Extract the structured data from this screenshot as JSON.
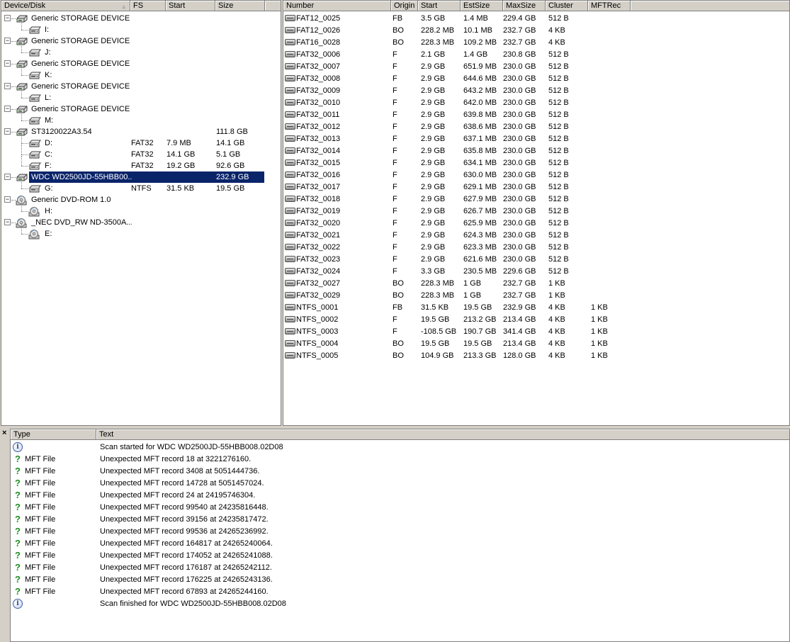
{
  "left": {
    "headers": [
      "Device/Disk",
      "FS",
      "Start",
      "Size"
    ],
    "rows": [
      {
        "kind": "disk",
        "name": "Generic STORAGE DEVICE ...",
        "fs": "",
        "start": "",
        "size": "",
        "icon": "usb-disk-icon"
      },
      {
        "kind": "part",
        "name": "I:",
        "fs": "",
        "start": "",
        "size": "",
        "icon": "drive-icon"
      },
      {
        "kind": "disk",
        "name": "Generic STORAGE DEVICE ...",
        "fs": "",
        "start": "",
        "size": "",
        "icon": "usb-disk-icon"
      },
      {
        "kind": "part",
        "name": "J:",
        "fs": "",
        "start": "",
        "size": "",
        "icon": "drive-icon"
      },
      {
        "kind": "disk",
        "name": "Generic STORAGE DEVICE ...",
        "fs": "",
        "start": "",
        "size": "",
        "icon": "usb-disk-icon"
      },
      {
        "kind": "part",
        "name": "K:",
        "fs": "",
        "start": "",
        "size": "",
        "icon": "drive-icon"
      },
      {
        "kind": "disk",
        "name": "Generic STORAGE DEVICE ...",
        "fs": "",
        "start": "",
        "size": "",
        "icon": "usb-disk-icon"
      },
      {
        "kind": "part",
        "name": "L:",
        "fs": "",
        "start": "",
        "size": "",
        "icon": "drive-icon"
      },
      {
        "kind": "disk",
        "name": "Generic STORAGE DEVICE ...",
        "fs": "",
        "start": "",
        "size": "",
        "icon": "usb-disk-icon"
      },
      {
        "kind": "part",
        "name": "M:",
        "fs": "",
        "start": "",
        "size": "",
        "icon": "drive-icon"
      },
      {
        "kind": "disk",
        "name": "ST3120022A3.54",
        "fs": "",
        "start": "",
        "size": "111.8 GB",
        "icon": "hard-disk-icon"
      },
      {
        "kind": "part",
        "name": "D:",
        "fs": "FAT32",
        "start": "7.9 MB",
        "size": "14.1 GB",
        "icon": "drive-icon"
      },
      {
        "kind": "part",
        "name": "C:",
        "fs": "FAT32",
        "start": "14.1 GB",
        "size": "5.1 GB",
        "icon": "drive-icon"
      },
      {
        "kind": "part",
        "name": "F:",
        "fs": "FAT32",
        "start": "19.2 GB",
        "size": "92.6 GB",
        "icon": "drive-icon"
      },
      {
        "kind": "disk",
        "name": "WDC WD2500JD-55HBB00...",
        "fs": "",
        "start": "",
        "size": "232.9 GB",
        "icon": "hard-disk-icon",
        "selected": true
      },
      {
        "kind": "part",
        "name": "G:",
        "fs": "NTFS",
        "start": "31.5 KB",
        "size": "19.5 GB",
        "icon": "drive-icon"
      },
      {
        "kind": "disk",
        "name": "Generic DVD-ROM 1.0",
        "fs": "",
        "start": "",
        "size": "",
        "icon": "cd-drive-icon"
      },
      {
        "kind": "part",
        "name": "H:",
        "fs": "",
        "start": "",
        "size": "",
        "icon": "cd-icon"
      },
      {
        "kind": "disk",
        "name": "_NEC DVD_RW ND-3500A...",
        "fs": "",
        "start": "",
        "size": "",
        "icon": "cd-drive-icon"
      },
      {
        "kind": "part",
        "name": "E:",
        "fs": "",
        "start": "",
        "size": "",
        "icon": "cd-icon"
      }
    ]
  },
  "right": {
    "headers": [
      "Number",
      "Origin",
      "Start",
      "EstSize",
      "MaxSize",
      "Cluster",
      "MFTRec"
    ],
    "rows": [
      [
        "FAT12_0025",
        "FB",
        "3.5 GB",
        "1.4 MB",
        "229.4 GB",
        "512 B",
        ""
      ],
      [
        "FAT12_0026",
        "BO",
        "228.2 MB",
        "10.1 MB",
        "232.7 GB",
        "4 KB",
        ""
      ],
      [
        "FAT16_0028",
        "BO",
        "228.3 MB",
        "109.2 MB",
        "232.7 GB",
        "4 KB",
        ""
      ],
      [
        "FAT32_0006",
        "F",
        "2.1 GB",
        "1.4 GB",
        "230.8 GB",
        "512 B",
        ""
      ],
      [
        "FAT32_0007",
        "F",
        "2.9 GB",
        "651.9 MB",
        "230.0 GB",
        "512 B",
        ""
      ],
      [
        "FAT32_0008",
        "F",
        "2.9 GB",
        "644.6 MB",
        "230.0 GB",
        "512 B",
        ""
      ],
      [
        "FAT32_0009",
        "F",
        "2.9 GB",
        "643.2 MB",
        "230.0 GB",
        "512 B",
        ""
      ],
      [
        "FAT32_0010",
        "F",
        "2.9 GB",
        "642.0 MB",
        "230.0 GB",
        "512 B",
        ""
      ],
      [
        "FAT32_0011",
        "F",
        "2.9 GB",
        "639.8 MB",
        "230.0 GB",
        "512 B",
        ""
      ],
      [
        "FAT32_0012",
        "F",
        "2.9 GB",
        "638.6 MB",
        "230.0 GB",
        "512 B",
        ""
      ],
      [
        "FAT32_0013",
        "F",
        "2.9 GB",
        "637.1 MB",
        "230.0 GB",
        "512 B",
        ""
      ],
      [
        "FAT32_0014",
        "F",
        "2.9 GB",
        "635.8 MB",
        "230.0 GB",
        "512 B",
        ""
      ],
      [
        "FAT32_0015",
        "F",
        "2.9 GB",
        "634.1 MB",
        "230.0 GB",
        "512 B",
        ""
      ],
      [
        "FAT32_0016",
        "F",
        "2.9 GB",
        "630.0 MB",
        "230.0 GB",
        "512 B",
        ""
      ],
      [
        "FAT32_0017",
        "F",
        "2.9 GB",
        "629.1 MB",
        "230.0 GB",
        "512 B",
        ""
      ],
      [
        "FAT32_0018",
        "F",
        "2.9 GB",
        "627.9 MB",
        "230.0 GB",
        "512 B",
        ""
      ],
      [
        "FAT32_0019",
        "F",
        "2.9 GB",
        "626.7 MB",
        "230.0 GB",
        "512 B",
        ""
      ],
      [
        "FAT32_0020",
        "F",
        "2.9 GB",
        "625.9 MB",
        "230.0 GB",
        "512 B",
        ""
      ],
      [
        "FAT32_0021",
        "F",
        "2.9 GB",
        "624.3 MB",
        "230.0 GB",
        "512 B",
        ""
      ],
      [
        "FAT32_0022",
        "F",
        "2.9 GB",
        "623.3 MB",
        "230.0 GB",
        "512 B",
        ""
      ],
      [
        "FAT32_0023",
        "F",
        "2.9 GB",
        "621.6 MB",
        "230.0 GB",
        "512 B",
        ""
      ],
      [
        "FAT32_0024",
        "F",
        "3.3 GB",
        "230.5 MB",
        "229.6 GB",
        "512 B",
        ""
      ],
      [
        "FAT32_0027",
        "BO",
        "228.3 MB",
        "1 GB",
        "232.7 GB",
        "1 KB",
        ""
      ],
      [
        "FAT32_0029",
        "BO",
        "228.3 MB",
        "1 GB",
        "232.7 GB",
        "1 KB",
        ""
      ],
      [
        "NTFS_0001",
        "FB",
        "31.5 KB",
        "19.5 GB",
        "232.9 GB",
        "4 KB",
        "1 KB"
      ],
      [
        "NTFS_0002",
        "F",
        "19.5 GB",
        "213.2 GB",
        "213.4 GB",
        "4 KB",
        "1 KB"
      ],
      [
        "NTFS_0003",
        "F",
        "-108.5 GB",
        "190.7 GB",
        "341.4 GB",
        "4 KB",
        "1 KB"
      ],
      [
        "NTFS_0004",
        "BO",
        "19.5 GB",
        "19.5 GB",
        "213.4 GB",
        "4 KB",
        "1 KB"
      ],
      [
        "NTFS_0005",
        "BO",
        "104.9 GB",
        "213.3 GB",
        "128.0 GB",
        "4 KB",
        "1 KB"
      ]
    ]
  },
  "log": {
    "close_label": "×",
    "headers": [
      "Type",
      "Text"
    ],
    "rows": [
      {
        "icon": "info",
        "type": "",
        "text": "Scan started for WDC WD2500JD-55HBB008.02D08"
      },
      {
        "icon": "question",
        "type": "MFT File",
        "text": "Unexpected MFT record 18 at 3221276160."
      },
      {
        "icon": "question",
        "type": "MFT File",
        "text": "Unexpected MFT record 3408 at 5051444736."
      },
      {
        "icon": "question",
        "type": "MFT File",
        "text": "Unexpected MFT record 14728 at 5051457024."
      },
      {
        "icon": "question",
        "type": "MFT File",
        "text": "Unexpected MFT record 24 at 24195746304."
      },
      {
        "icon": "question",
        "type": "MFT File",
        "text": "Unexpected MFT record 99540 at 24235816448."
      },
      {
        "icon": "question",
        "type": "MFT File",
        "text": "Unexpected MFT record 39156 at 24235817472."
      },
      {
        "icon": "question",
        "type": "MFT File",
        "text": "Unexpected MFT record 99536 at 24265236992."
      },
      {
        "icon": "question",
        "type": "MFT File",
        "text": "Unexpected MFT record 164817 at 24265240064."
      },
      {
        "icon": "question",
        "type": "MFT File",
        "text": "Unexpected MFT record 174052 at 24265241088."
      },
      {
        "icon": "question",
        "type": "MFT File",
        "text": "Unexpected MFT record 176187 at 24265242112."
      },
      {
        "icon": "question",
        "type": "MFT File",
        "text": "Unexpected MFT record 176225 at 24265243136."
      },
      {
        "icon": "question",
        "type": "MFT File",
        "text": "Unexpected MFT record 67893 at 24265244160."
      },
      {
        "icon": "info",
        "type": "",
        "text": "Scan finished for WDC WD2500JD-55HBB008.02D08"
      }
    ]
  },
  "colors": {
    "selection": "#0a246a",
    "question_icon": "#1f8f1f",
    "chrome": "#d4d0c8"
  }
}
